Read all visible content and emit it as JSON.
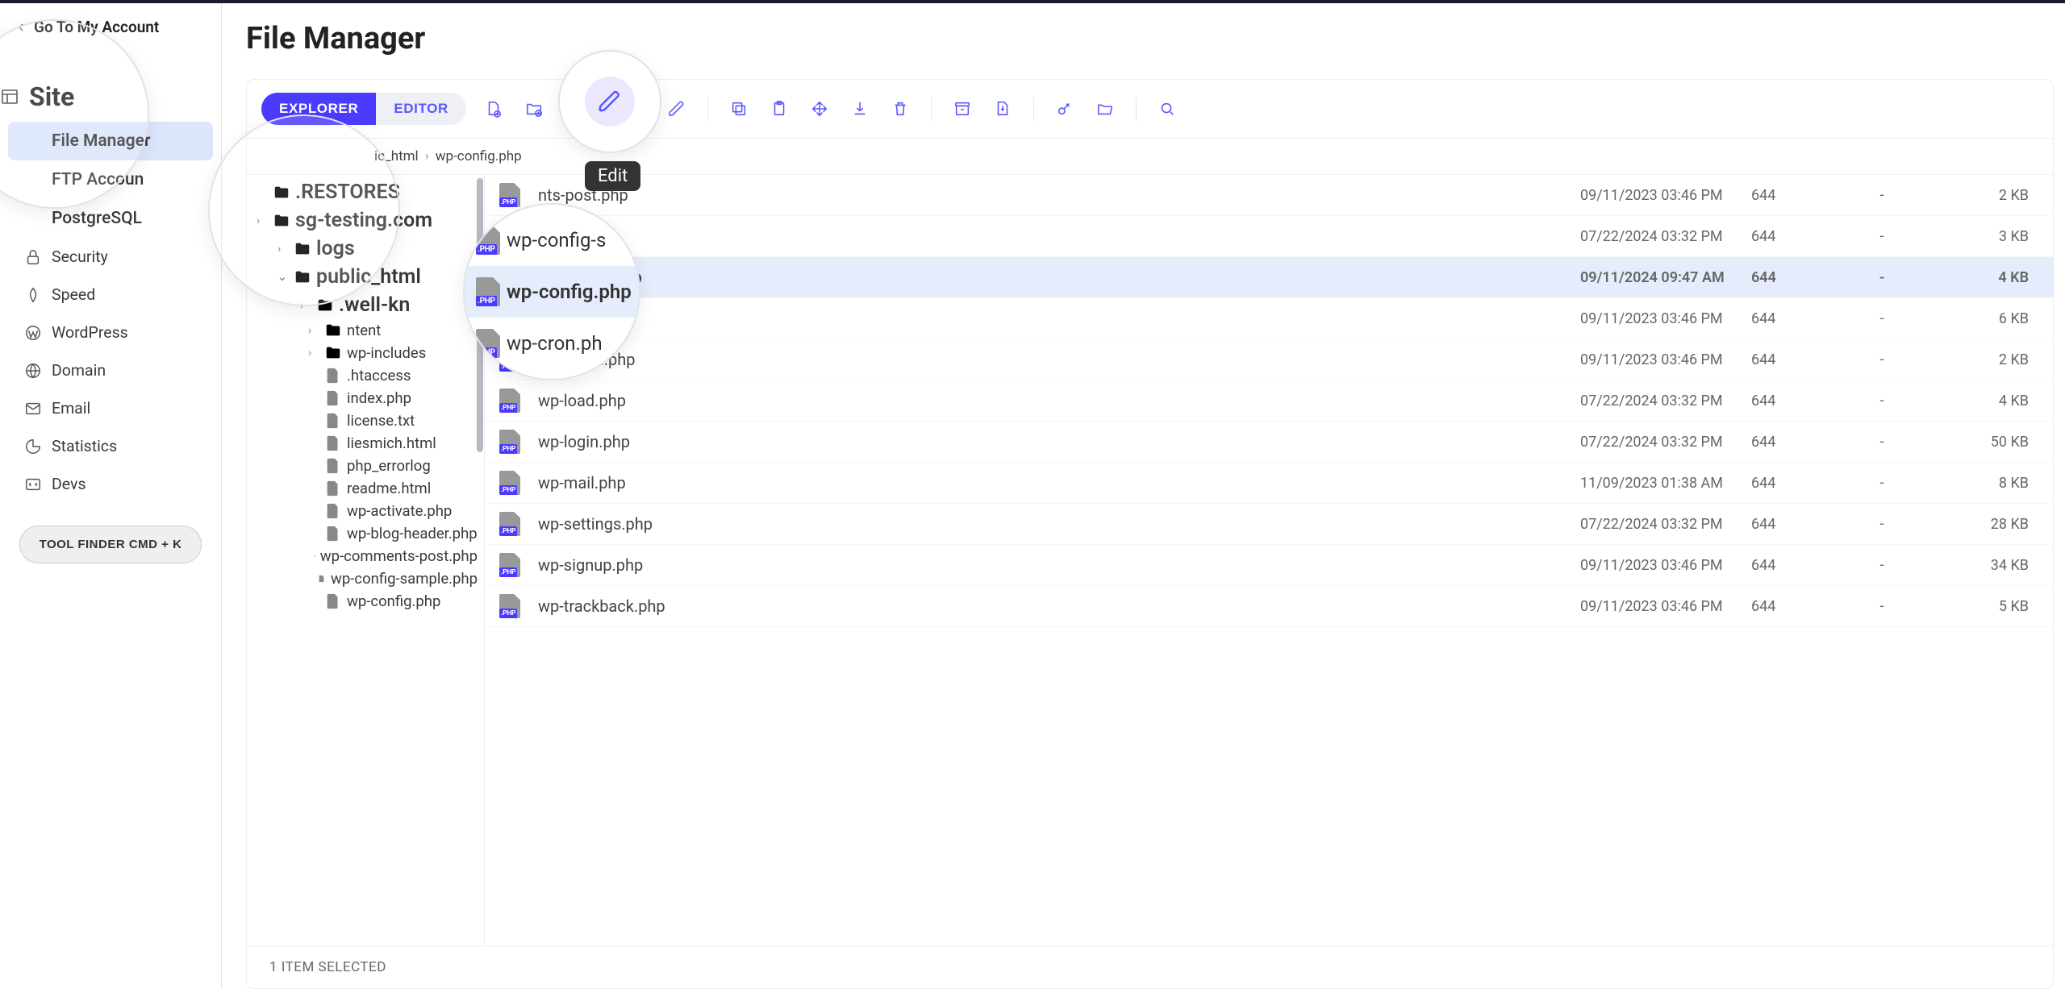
{
  "header": {
    "go_account": "Go To My Account"
  },
  "sidebar": {
    "site_label": "Site",
    "items": [
      {
        "label": "File Manager",
        "indent": true,
        "active": true
      },
      {
        "label": "FTP Accoun",
        "indent": true
      },
      {
        "label": "PostgreSQL",
        "indent": true
      },
      {
        "label": "Security",
        "icon": "lock"
      },
      {
        "label": "Speed",
        "icon": "speed"
      },
      {
        "label": "WordPress",
        "icon": "wordpress"
      },
      {
        "label": "Domain",
        "icon": "globe"
      },
      {
        "label": "Email",
        "icon": "mail"
      },
      {
        "label": "Statistics",
        "icon": "chart"
      },
      {
        "label": "Devs",
        "icon": "code"
      }
    ],
    "tool_finder": "TOOL FINDER CMD + K"
  },
  "page": {
    "title": "File Manager"
  },
  "toolbar": {
    "tabs": {
      "explorer": "EXPLORER",
      "editor": "EDITOR"
    },
    "edit_tooltip": "Edit"
  },
  "breadcrumbs": [
    "ic_html",
    "wp-config.php"
  ],
  "tree": [
    {
      "label": ".RESTORES",
      "type": "folder",
      "depth": 0,
      "expand": "none",
      "big": true
    },
    {
      "label": "sg-testing.com",
      "type": "folder",
      "depth": 0,
      "expand": "closed",
      "big": true
    },
    {
      "label": "logs",
      "type": "folder",
      "depth": 1,
      "expand": "closed",
      "big": true
    },
    {
      "label": "public_html",
      "type": "folder",
      "depth": 1,
      "expand": "open",
      "active": true,
      "big": true
    },
    {
      "label": ".well-kn",
      "type": "folder",
      "depth": 2,
      "expand": "closed",
      "big": true
    },
    {
      "label": "ntent",
      "type": "folder",
      "depth": 3,
      "expand": "closed"
    },
    {
      "label": "wp-includes",
      "type": "folder",
      "depth": 3,
      "expand": "closed"
    },
    {
      "label": ".htaccess",
      "type": "file",
      "depth": 3
    },
    {
      "label": "index.php",
      "type": "file",
      "depth": 3
    },
    {
      "label": "license.txt",
      "type": "file",
      "depth": 3
    },
    {
      "label": "liesmich.html",
      "type": "file",
      "depth": 3
    },
    {
      "label": "php_errorlog",
      "type": "file",
      "depth": 3
    },
    {
      "label": "readme.html",
      "type": "file",
      "depth": 3
    },
    {
      "label": "wp-activate.php",
      "type": "file",
      "depth": 3
    },
    {
      "label": "wp-blog-header.php",
      "type": "file",
      "depth": 3
    },
    {
      "label": "wp-comments-post.php",
      "type": "file",
      "depth": 3
    },
    {
      "label": "wp-config-sample.php",
      "type": "file",
      "depth": 3
    },
    {
      "label": "wp-config.php",
      "type": "file",
      "depth": 3
    }
  ],
  "files": [
    {
      "name": "nts-post.php",
      "date": "09/11/2023 03:46 PM",
      "perm": "644",
      "owner": "-",
      "size": "2 KB"
    },
    {
      "name": ".php",
      "date": "07/22/2024 03:32 PM",
      "perm": "644",
      "owner": "-",
      "size": "3 KB"
    },
    {
      "name": "wp-config.php",
      "date": "09/11/2024 09:47 AM",
      "perm": "644",
      "owner": "-",
      "size": "4 KB",
      "selected": true
    },
    {
      "name": "",
      "date": "09/11/2023 03:46 PM",
      "perm": "644",
      "owner": "-",
      "size": "6 KB"
    },
    {
      "name": "wp  -opml.php",
      "date": "09/11/2023 03:46 PM",
      "perm": "644",
      "owner": "-",
      "size": "2 KB"
    },
    {
      "name": "wp-load.php",
      "date": "07/22/2024 03:32 PM",
      "perm": "644",
      "owner": "-",
      "size": "4 KB"
    },
    {
      "name": "wp-login.php",
      "date": "07/22/2024 03:32 PM",
      "perm": "644",
      "owner": "-",
      "size": "50 KB"
    },
    {
      "name": "wp-mail.php",
      "date": "11/09/2023 01:38 AM",
      "perm": "644",
      "owner": "-",
      "size": "8 KB"
    },
    {
      "name": "wp-settings.php",
      "date": "07/22/2024 03:32 PM",
      "perm": "644",
      "owner": "-",
      "size": "28 KB"
    },
    {
      "name": "wp-signup.php",
      "date": "09/11/2023 03:46 PM",
      "perm": "644",
      "owner": "-",
      "size": "34 KB"
    },
    {
      "name": "wp-trackback.php",
      "date": "09/11/2023 03:46 PM",
      "perm": "644",
      "owner": "-",
      "size": "5 KB"
    }
  ],
  "callout_file": {
    "prev": "wp-config-s",
    "sel": "wp-config.php",
    "next": "wp-cron.ph"
  },
  "status": {
    "selected": "1 ITEM SELECTED"
  }
}
